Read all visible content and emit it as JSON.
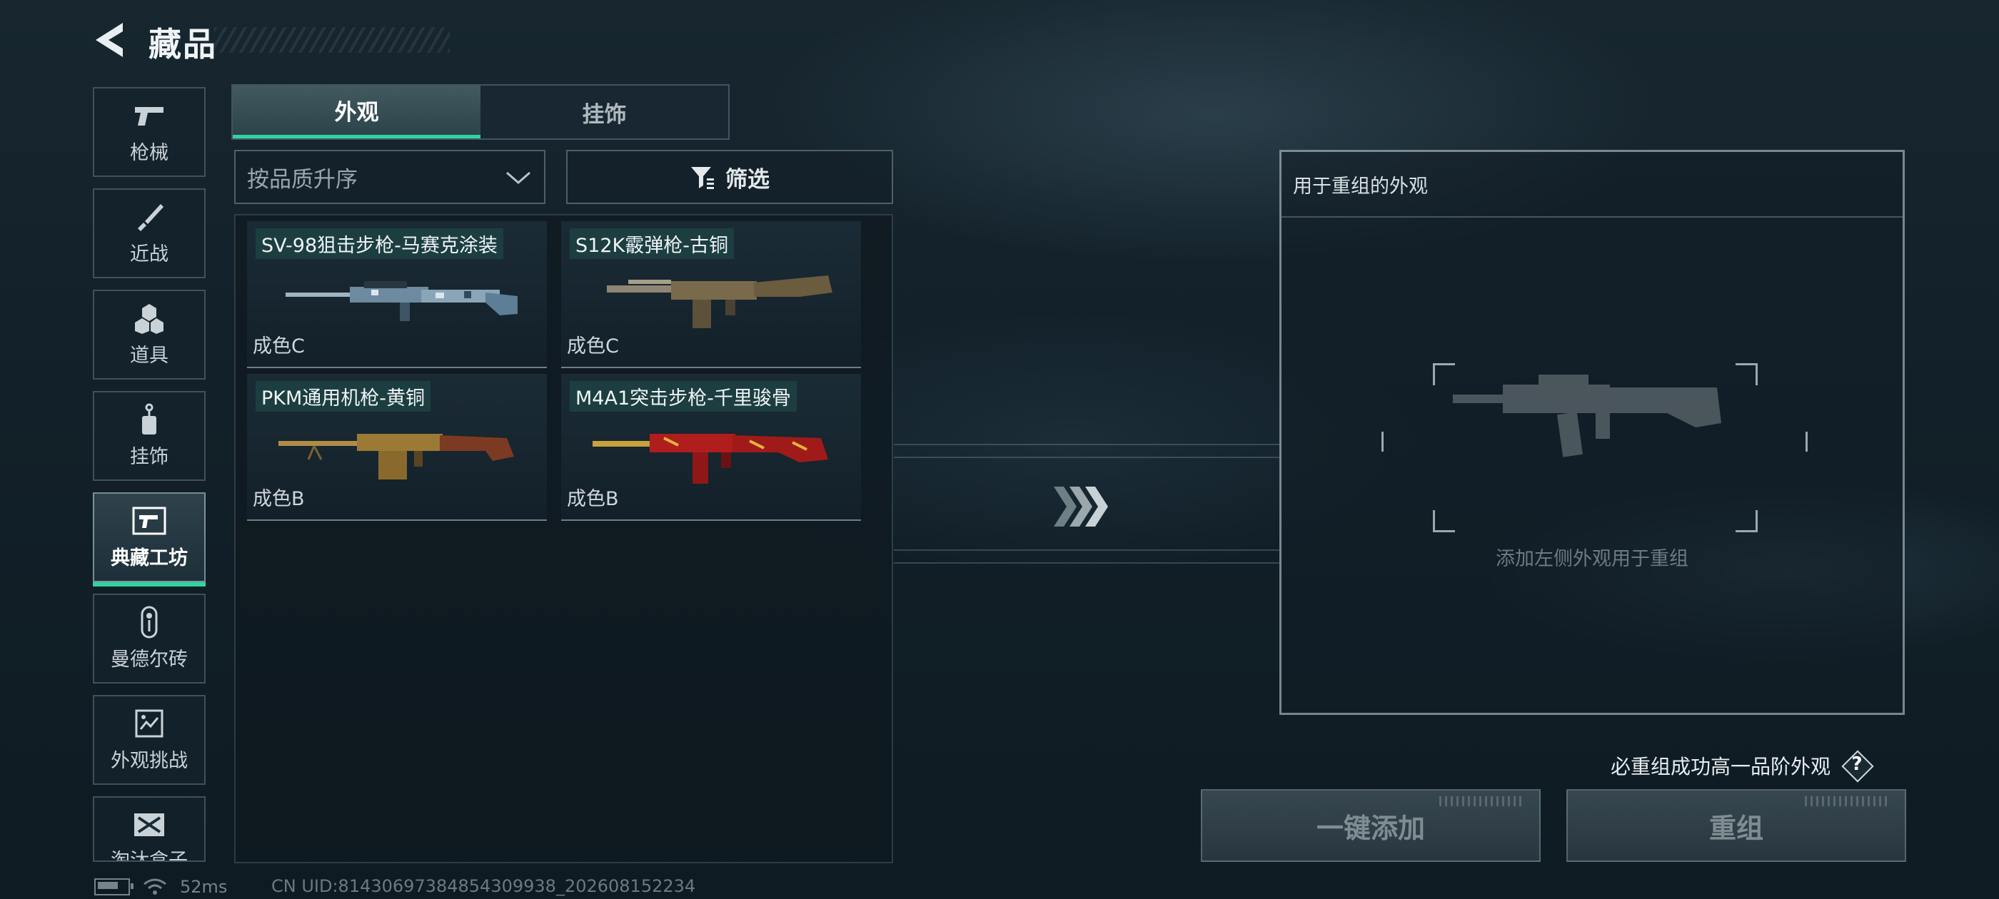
{
  "header": {
    "title": "藏品"
  },
  "sidebar": {
    "items": [
      {
        "label": "枪械",
        "icon": "pistol-icon"
      },
      {
        "label": "近战",
        "icon": "knife-icon"
      },
      {
        "label": "道具",
        "icon": "grenade-icon"
      },
      {
        "label": "挂饰",
        "icon": "pendant-icon"
      },
      {
        "label": "典藏工坊",
        "icon": "workshop-icon",
        "active": true
      },
      {
        "label": "曼德尔砖",
        "icon": "brick-icon"
      },
      {
        "label": "外观挑战",
        "icon": "challenge-icon"
      },
      {
        "label": "淘汰盒子",
        "icon": "box-icon"
      }
    ]
  },
  "tabs": [
    {
      "label": "外观",
      "active": true
    },
    {
      "label": "挂饰",
      "active": false
    }
  ],
  "sort": {
    "value": "按品质升序"
  },
  "filter": {
    "label": "筛选"
  },
  "items": [
    {
      "name": "SV-98狙击步枪-马赛克涂装",
      "grade": "成色C",
      "color": "#5c7e96"
    },
    {
      "name": "S12K霰弹枪-古铜",
      "grade": "成色C",
      "color": "#7a6a4c"
    },
    {
      "name": "PKM通用机枪-黄铜",
      "grade": "成色B",
      "color": "#9b7a36"
    },
    {
      "name": "M4A1突击步枪-千里骏骨",
      "grade": "成色B",
      "color": "#b01d1d"
    }
  ],
  "recombine": {
    "title": "用于重组的外观",
    "hint": "添加左侧外观用于重组",
    "guarantee": "必重组成功高一品阶外观",
    "help": "?",
    "add_all": "一键添加",
    "recombine": "重组"
  },
  "status": {
    "ping": "52ms",
    "uid": "CN UID:8143069738485430993​8_202608152234"
  },
  "colors": {
    "accent": "#2fd5a0"
  }
}
